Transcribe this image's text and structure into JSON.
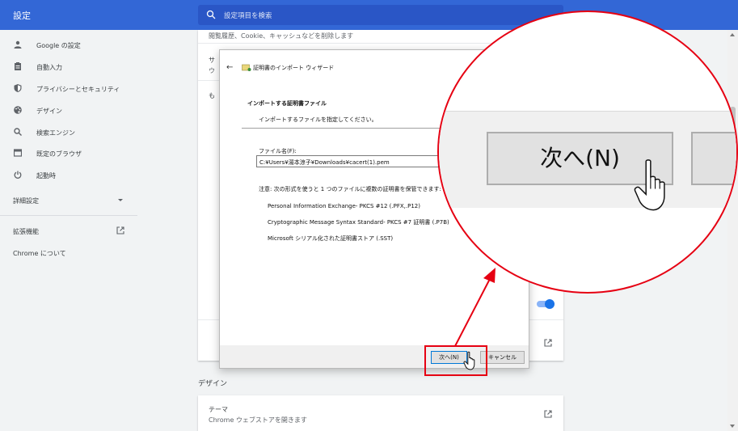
{
  "header": {
    "title": "設定",
    "search_placeholder": "設定項目を検索"
  },
  "sidebar": {
    "items": [
      {
        "label": "Google の設定",
        "icon": "person-icon"
      },
      {
        "label": "自動入力",
        "icon": "clipboard-icon"
      },
      {
        "label": "プライバシーとセキュリティ",
        "icon": "shield-icon"
      },
      {
        "label": "デザイン",
        "icon": "palette-icon"
      },
      {
        "label": "検索エンジン",
        "icon": "search-icon"
      },
      {
        "label": "既定のブラウザ",
        "icon": "browser-icon"
      },
      {
        "label": "起動時",
        "icon": "power-icon"
      }
    ],
    "advanced": "詳細設定",
    "extensions": "拡張機能",
    "about": "Chrome について"
  },
  "main": {
    "clear_data_sub": "閲覧履歴、Cookie、キャッシュなどを削除します",
    "row2_title": "サ",
    "row2_sub": "ウ",
    "row3_title": "も",
    "design_heading": "デザイン",
    "theme": {
      "title": "テーマ",
      "subtitle": "Chrome ウェブストアを開きます"
    }
  },
  "wizard": {
    "back": "←",
    "title": "証明書のインポート ウィザード",
    "heading": "インポートする証明書ファイル",
    "subheading": "インポートするファイルを指定してください。",
    "file_label": "ファイル名(F):",
    "file_value": "C:¥Users¥湯本涼子¥Downloads¥cacert(1).pem",
    "note": "注意: 次の形式を使うと 1 つのファイルに複数の証明書を保管できます:",
    "formats": [
      "Personal Information Exchange- PKCS #12 (.PFX,.P12)",
      "Cryptographic Message Syntax Standard- PKCS #7 証明書 (.P7B)",
      "Microsoft シリアル化された証明書ストア (.SST)"
    ],
    "next_button": "次へ(N)",
    "cancel_button": "キャンセル"
  },
  "zoom": {
    "next_button": "次へ(N)"
  },
  "colors": {
    "header": "#3367d6",
    "accent": "#1a73e8",
    "annotation": "#e60012"
  }
}
